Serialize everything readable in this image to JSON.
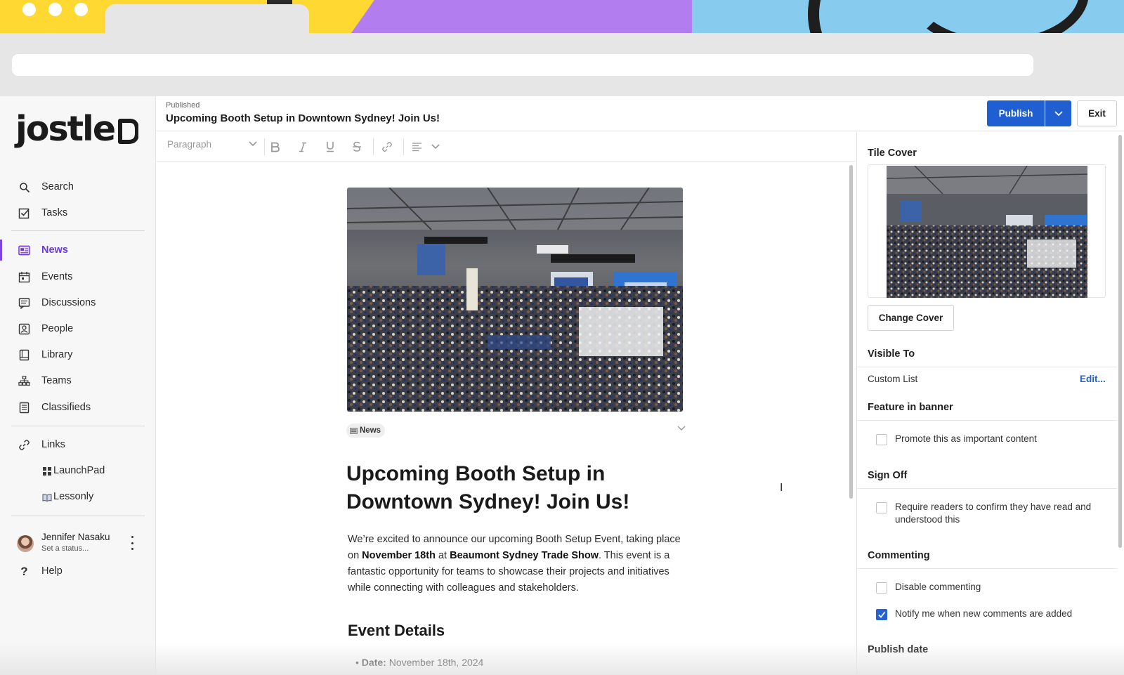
{
  "header": {
    "status": "Published",
    "title": "Upcoming Booth Setup in Downtown Sydney! Join Us!",
    "publish_label": "Publish",
    "exit_label": "Exit"
  },
  "brand": {
    "logo_text": "jostle"
  },
  "sidebar": {
    "items": [
      {
        "label": "Search",
        "icon": "search-icon"
      },
      {
        "label": "Tasks",
        "icon": "checkbox-icon"
      },
      {
        "label": "News",
        "icon": "news-icon",
        "active": true
      },
      {
        "label": "Events",
        "icon": "calendar-icon"
      },
      {
        "label": "Discussions",
        "icon": "chat-icon"
      },
      {
        "label": "People",
        "icon": "person-icon"
      },
      {
        "label": "Library",
        "icon": "book-icon"
      },
      {
        "label": "Teams",
        "icon": "org-chart-icon"
      },
      {
        "label": "Classifieds",
        "icon": "list-icon"
      },
      {
        "label": "Links",
        "icon": "link-icon"
      },
      {
        "label": "LaunchPad",
        "icon": "grid-icon"
      },
      {
        "label": "Lessonly",
        "icon": "open-book-icon"
      }
    ],
    "user": {
      "name": "Jennifer Nasaku",
      "status": "Set a status..."
    },
    "help_label": "Help"
  },
  "toolbar": {
    "block_style": "Paragraph"
  },
  "article": {
    "tag": "News",
    "title": "Upcoming Booth Setup in Downtown Sydney! Join Us!",
    "body_1": "We’re excited to announce our upcoming Booth Setup Event, taking place on ",
    "body_date": "November 18th",
    "body_2": " at ",
    "body_venue": "Beaumont Sydney Trade Show",
    "body_3": ". This event is a fantastic opportunity for teams to showcase their projects and initiatives while connecting with colleagues and stakeholders.",
    "subheading": "Event Details",
    "detail_label": "Date:",
    "detail_value": " November 18th, 2024"
  },
  "panel": {
    "tile_cover_title": "Tile Cover",
    "change_cover_label": "Change Cover",
    "visible_to_title": "Visible To",
    "visible_to_value": "Custom List",
    "visible_to_edit": "Edit...",
    "feature_title": "Feature in banner",
    "feature_option": "Promote this as important content",
    "feature_checked": false,
    "signoff_title": "Sign Off",
    "signoff_option": "Require readers to confirm they have read and understood this",
    "signoff_checked": false,
    "commenting_title": "Commenting",
    "disable_comments": "Disable commenting",
    "disable_comments_checked": false,
    "notify_comments": "Notify me when new comments are added",
    "notify_comments_checked": true,
    "publish_date_title": "Publish date"
  },
  "colors": {
    "accent": "#1f5fd1",
    "active_nav": "#6c3ad6"
  }
}
